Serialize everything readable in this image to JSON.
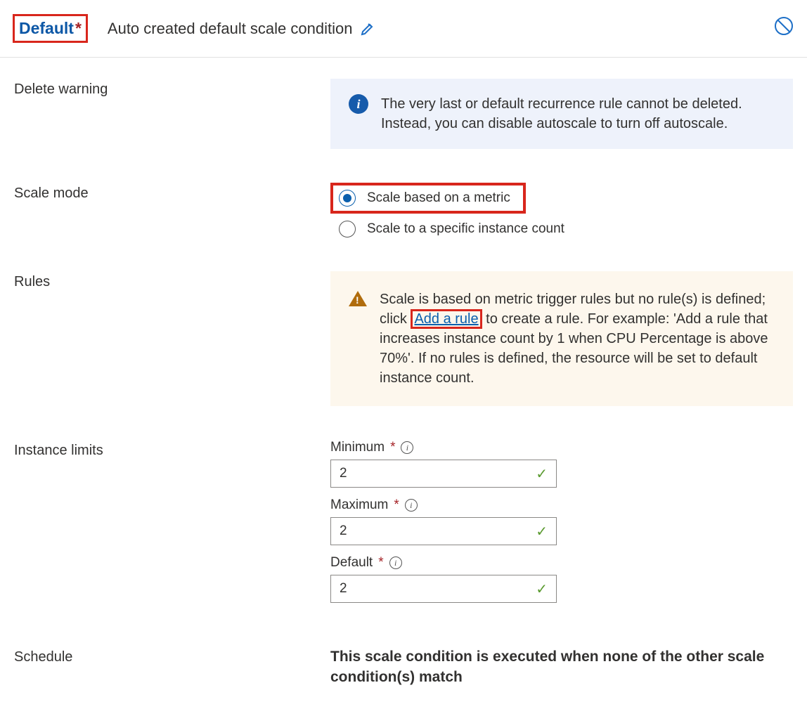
{
  "header": {
    "tab_label": "Default",
    "condition_name": "Auto created default scale condition"
  },
  "sections": {
    "delete_warning": {
      "label": "Delete warning",
      "message": "The very last or default recurrence rule cannot be deleted. Instead, you can disable autoscale to turn off autoscale."
    },
    "scale_mode": {
      "label": "Scale mode",
      "options": {
        "metric": "Scale based on a metric",
        "instance": "Scale to a specific instance count"
      }
    },
    "rules": {
      "label": "Rules",
      "warning_pre": "Scale is based on metric trigger rules but no rule(s) is defined; click ",
      "link_text": "Add a rule",
      "warning_post": " to create a rule. For example: 'Add a rule that increases instance count by 1 when CPU Percentage is above 70%'. If no rules is defined, the resource will be set to default instance count."
    },
    "instance_limits": {
      "label": "Instance limits",
      "minimum_label": "Minimum",
      "minimum_value": "2",
      "maximum_label": "Maximum",
      "maximum_value": "2",
      "default_label": "Default",
      "default_value": "2"
    },
    "schedule": {
      "label": "Schedule",
      "text": "This scale condition is executed when none of the other scale condition(s) match"
    }
  }
}
